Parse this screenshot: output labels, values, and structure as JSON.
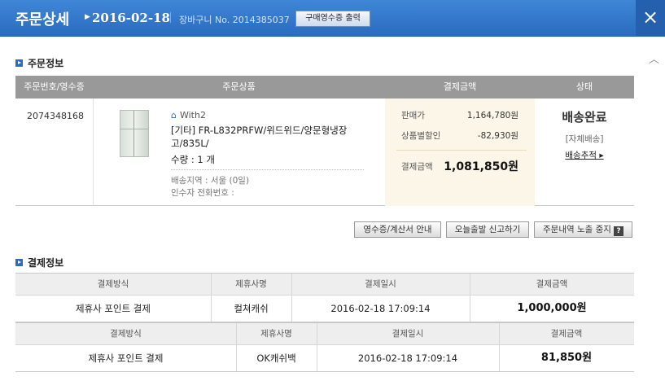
{
  "header": {
    "title": "주문상세",
    "date": "2016-02-18",
    "order_no_label": "장바구니 No. 2014385037",
    "receipt_button": "구매영수증 출력",
    "close_icon": "×"
  },
  "order_section": {
    "title": "주문정보",
    "columns": [
      "주문번호/영수증",
      "주문상품",
      "결제금액",
      "상태"
    ],
    "order_number": "2074348168",
    "seller": "With2",
    "product_name": "[기타] FR-L832PRFW/위드위드/양문형냉장고/835L/",
    "quantity": "수량 : 1 개",
    "ship_area": "배송지역 : 서울 (0일)",
    "recipient_phone": "인수자 전화번호 :",
    "price": {
      "sale_label": "판매가",
      "sale_value": "1,164,780원",
      "discount_label": "상품별할인",
      "discount_value": "-82,930원",
      "total_label": "결제금액",
      "total_value": "1,081,850원"
    },
    "status": {
      "main": "배송완료",
      "sub": "[자체배송]",
      "track": "배송추적 ▸"
    }
  },
  "actions": {
    "receipt_info": "영수증/계산서 안내",
    "report_delay": "오늘출발 신고하기",
    "hide_order": "주문내역 노출 중지",
    "help_glyph": "?"
  },
  "payment_section": {
    "title": "결제정보",
    "tables": [
      {
        "headers": [
          "결제방식",
          "제휴사명",
          "결제일시",
          "결제금액"
        ],
        "row": [
          "제휴사 포인트 결제",
          "컬쳐캐쉬",
          "2016-02-18 17:09:14",
          "1,000,000원"
        ]
      },
      {
        "headers": [
          "결제방식",
          "제휴사명",
          "결제일시",
          "결제금액"
        ],
        "row": [
          "제휴사 포인트 결제",
          "OK캐쉬백",
          "2016-02-18 17:09:14",
          "81,850원"
        ]
      }
    ]
  },
  "colors": {
    "header_blue": "#2a6cc0",
    "table_header_gray": "#999999",
    "price_bg": "#fbf6e8"
  },
  "icons": [
    "close-icon",
    "home-icon",
    "section-bullet-icon",
    "scroll-up-icon",
    "help-icon"
  ]
}
